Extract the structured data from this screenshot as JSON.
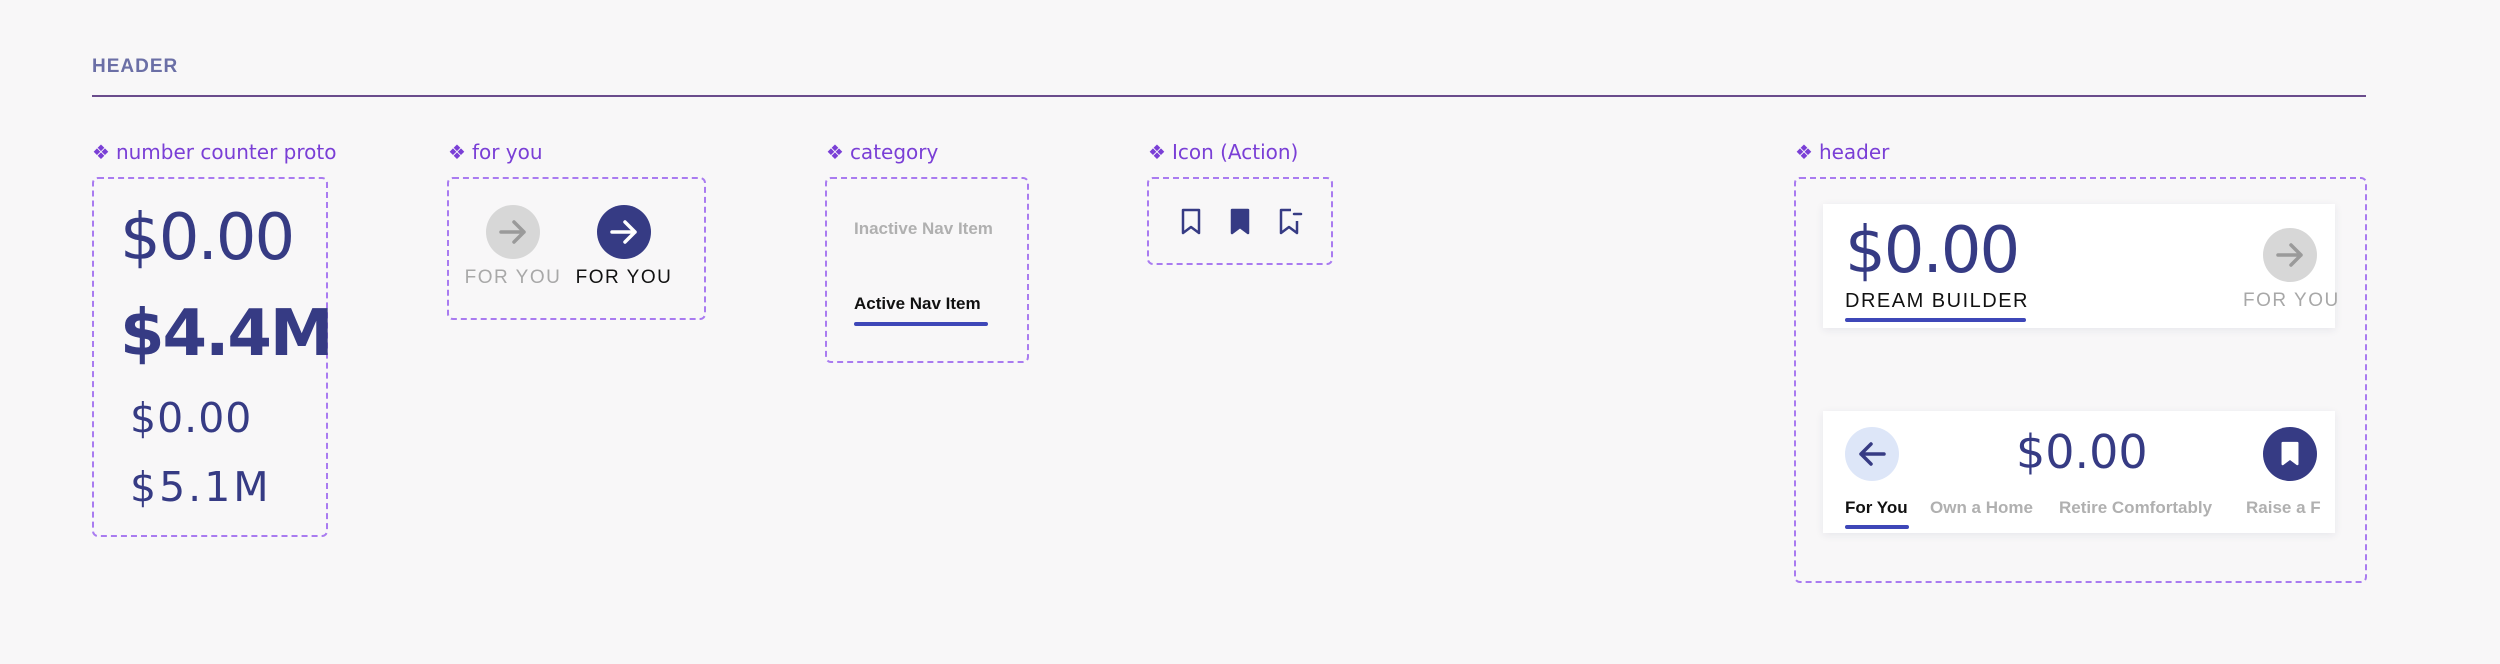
{
  "section": {
    "title": "HEADER"
  },
  "components": {
    "number_counter": {
      "label": "number counter proto",
      "values": [
        "$0.00",
        "$4.4M",
        "$0.00",
        "$5.1M"
      ]
    },
    "for_you": {
      "label": "for you",
      "inactive_label": "FOR YOU",
      "active_label": "FOR YOU"
    },
    "category": {
      "label": "category",
      "inactive_label": "Inactive Nav Item",
      "active_label": "Active Nav Item"
    },
    "icon_action": {
      "label": "Icon (Action)",
      "icons": [
        "bookmark-outline-icon",
        "bookmark-filled-icon",
        "bookmark-remove-icon"
      ]
    },
    "header": {
      "label": "header",
      "top_card": {
        "amount": "$0.00",
        "title": "DREAM BUILDER",
        "for_you_label": "FOR YOU"
      },
      "bottom_card": {
        "amount": "$0.00",
        "tabs": [
          "For You",
          "Own a Home",
          "Retire Comfortably",
          "Raise a F"
        ],
        "active_tab_index": 0
      }
    }
  },
  "colors": {
    "navy": "#363b84",
    "accent_purple": "#7a3fd6",
    "frame_dash": "#a97bf0",
    "inactive_grey": "#a8a8a8",
    "underline_blue": "#3e47b8"
  }
}
